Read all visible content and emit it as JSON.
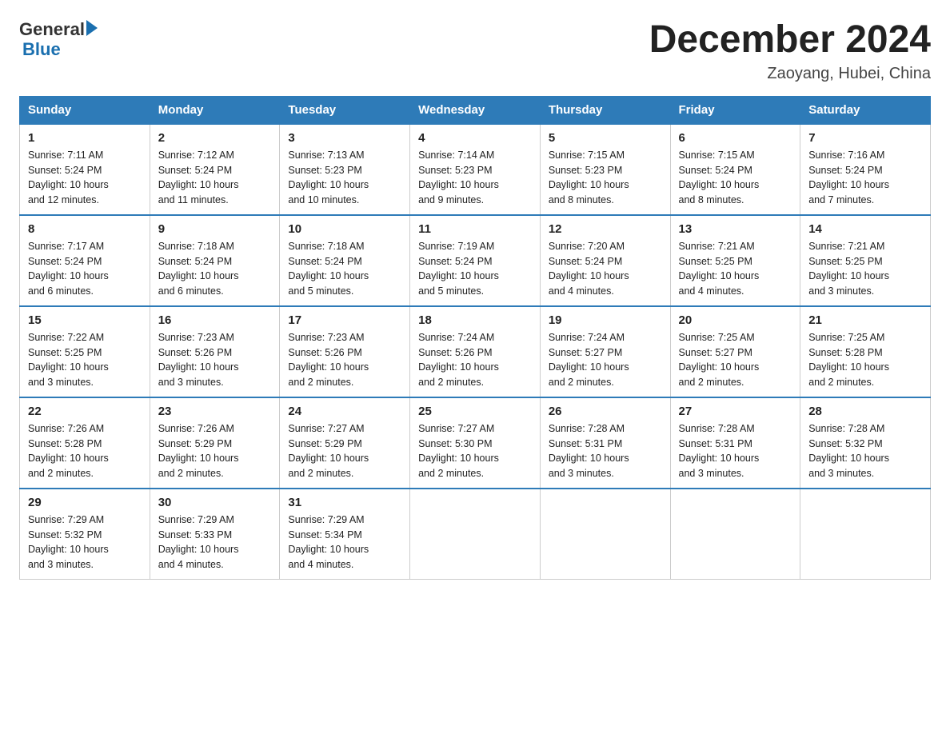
{
  "header": {
    "logo_general": "General",
    "logo_blue": "Blue",
    "title": "December 2024",
    "location": "Zaoyang, Hubei, China"
  },
  "days_of_week": [
    "Sunday",
    "Monday",
    "Tuesday",
    "Wednesday",
    "Thursday",
    "Friday",
    "Saturday"
  ],
  "weeks": [
    [
      {
        "num": "1",
        "info": "Sunrise: 7:11 AM\nSunset: 5:24 PM\nDaylight: 10 hours\nand 12 minutes."
      },
      {
        "num": "2",
        "info": "Sunrise: 7:12 AM\nSunset: 5:24 PM\nDaylight: 10 hours\nand 11 minutes."
      },
      {
        "num": "3",
        "info": "Sunrise: 7:13 AM\nSunset: 5:23 PM\nDaylight: 10 hours\nand 10 minutes."
      },
      {
        "num": "4",
        "info": "Sunrise: 7:14 AM\nSunset: 5:23 PM\nDaylight: 10 hours\nand 9 minutes."
      },
      {
        "num": "5",
        "info": "Sunrise: 7:15 AM\nSunset: 5:23 PM\nDaylight: 10 hours\nand 8 minutes."
      },
      {
        "num": "6",
        "info": "Sunrise: 7:15 AM\nSunset: 5:24 PM\nDaylight: 10 hours\nand 8 minutes."
      },
      {
        "num": "7",
        "info": "Sunrise: 7:16 AM\nSunset: 5:24 PM\nDaylight: 10 hours\nand 7 minutes."
      }
    ],
    [
      {
        "num": "8",
        "info": "Sunrise: 7:17 AM\nSunset: 5:24 PM\nDaylight: 10 hours\nand 6 minutes."
      },
      {
        "num": "9",
        "info": "Sunrise: 7:18 AM\nSunset: 5:24 PM\nDaylight: 10 hours\nand 6 minutes."
      },
      {
        "num": "10",
        "info": "Sunrise: 7:18 AM\nSunset: 5:24 PM\nDaylight: 10 hours\nand 5 minutes."
      },
      {
        "num": "11",
        "info": "Sunrise: 7:19 AM\nSunset: 5:24 PM\nDaylight: 10 hours\nand 5 minutes."
      },
      {
        "num": "12",
        "info": "Sunrise: 7:20 AM\nSunset: 5:24 PM\nDaylight: 10 hours\nand 4 minutes."
      },
      {
        "num": "13",
        "info": "Sunrise: 7:21 AM\nSunset: 5:25 PM\nDaylight: 10 hours\nand 4 minutes."
      },
      {
        "num": "14",
        "info": "Sunrise: 7:21 AM\nSunset: 5:25 PM\nDaylight: 10 hours\nand 3 minutes."
      }
    ],
    [
      {
        "num": "15",
        "info": "Sunrise: 7:22 AM\nSunset: 5:25 PM\nDaylight: 10 hours\nand 3 minutes."
      },
      {
        "num": "16",
        "info": "Sunrise: 7:23 AM\nSunset: 5:26 PM\nDaylight: 10 hours\nand 3 minutes."
      },
      {
        "num": "17",
        "info": "Sunrise: 7:23 AM\nSunset: 5:26 PM\nDaylight: 10 hours\nand 2 minutes."
      },
      {
        "num": "18",
        "info": "Sunrise: 7:24 AM\nSunset: 5:26 PM\nDaylight: 10 hours\nand 2 minutes."
      },
      {
        "num": "19",
        "info": "Sunrise: 7:24 AM\nSunset: 5:27 PM\nDaylight: 10 hours\nand 2 minutes."
      },
      {
        "num": "20",
        "info": "Sunrise: 7:25 AM\nSunset: 5:27 PM\nDaylight: 10 hours\nand 2 minutes."
      },
      {
        "num": "21",
        "info": "Sunrise: 7:25 AM\nSunset: 5:28 PM\nDaylight: 10 hours\nand 2 minutes."
      }
    ],
    [
      {
        "num": "22",
        "info": "Sunrise: 7:26 AM\nSunset: 5:28 PM\nDaylight: 10 hours\nand 2 minutes."
      },
      {
        "num": "23",
        "info": "Sunrise: 7:26 AM\nSunset: 5:29 PM\nDaylight: 10 hours\nand 2 minutes."
      },
      {
        "num": "24",
        "info": "Sunrise: 7:27 AM\nSunset: 5:29 PM\nDaylight: 10 hours\nand 2 minutes."
      },
      {
        "num": "25",
        "info": "Sunrise: 7:27 AM\nSunset: 5:30 PM\nDaylight: 10 hours\nand 2 minutes."
      },
      {
        "num": "26",
        "info": "Sunrise: 7:28 AM\nSunset: 5:31 PM\nDaylight: 10 hours\nand 3 minutes."
      },
      {
        "num": "27",
        "info": "Sunrise: 7:28 AM\nSunset: 5:31 PM\nDaylight: 10 hours\nand 3 minutes."
      },
      {
        "num": "28",
        "info": "Sunrise: 7:28 AM\nSunset: 5:32 PM\nDaylight: 10 hours\nand 3 minutes."
      }
    ],
    [
      {
        "num": "29",
        "info": "Sunrise: 7:29 AM\nSunset: 5:32 PM\nDaylight: 10 hours\nand 3 minutes."
      },
      {
        "num": "30",
        "info": "Sunrise: 7:29 AM\nSunset: 5:33 PM\nDaylight: 10 hours\nand 4 minutes."
      },
      {
        "num": "31",
        "info": "Sunrise: 7:29 AM\nSunset: 5:34 PM\nDaylight: 10 hours\nand 4 minutes."
      },
      {
        "num": "",
        "info": ""
      },
      {
        "num": "",
        "info": ""
      },
      {
        "num": "",
        "info": ""
      },
      {
        "num": "",
        "info": ""
      }
    ]
  ]
}
